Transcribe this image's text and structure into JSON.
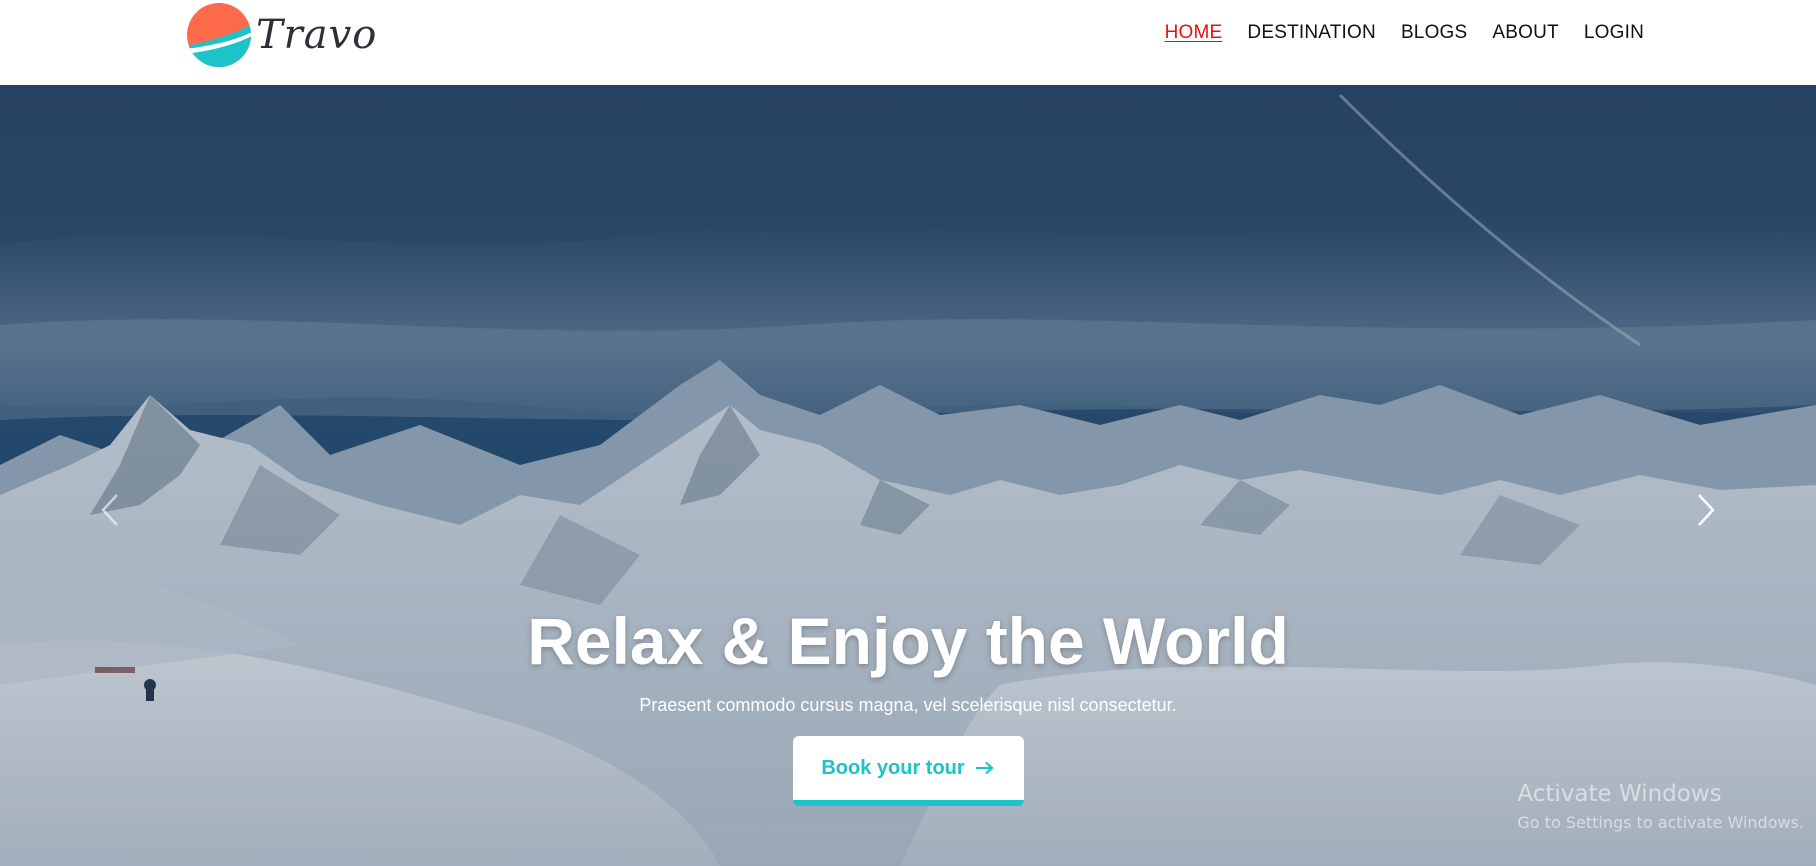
{
  "brand": {
    "name": "Travo",
    "logo_colors": {
      "primary": "#ff6b4a",
      "secondary": "#1cc3c9"
    }
  },
  "nav": {
    "items": [
      {
        "label": "HOME",
        "active": true
      },
      {
        "label": "DESTINATION",
        "active": false
      },
      {
        "label": "BLOGS",
        "active": false
      },
      {
        "label": "ABOUT",
        "active": false
      },
      {
        "label": "LOGIN",
        "active": false
      }
    ],
    "active_color": "#e8110f"
  },
  "hero": {
    "title": "Relax & Enjoy the World",
    "subtitle": "Praesent commodo cursus magna, vel scelerisque nisl consectetur.",
    "button_label": "Book your tour",
    "button_icon": "arrow-right-icon",
    "accent_color": "#1cc3c9",
    "prev_icon": "chevron-left-icon",
    "next_icon": "chevron-right-icon"
  },
  "watermark": {
    "title": "Activate Windows",
    "subtitle": "Go to Settings to activate Windows."
  }
}
